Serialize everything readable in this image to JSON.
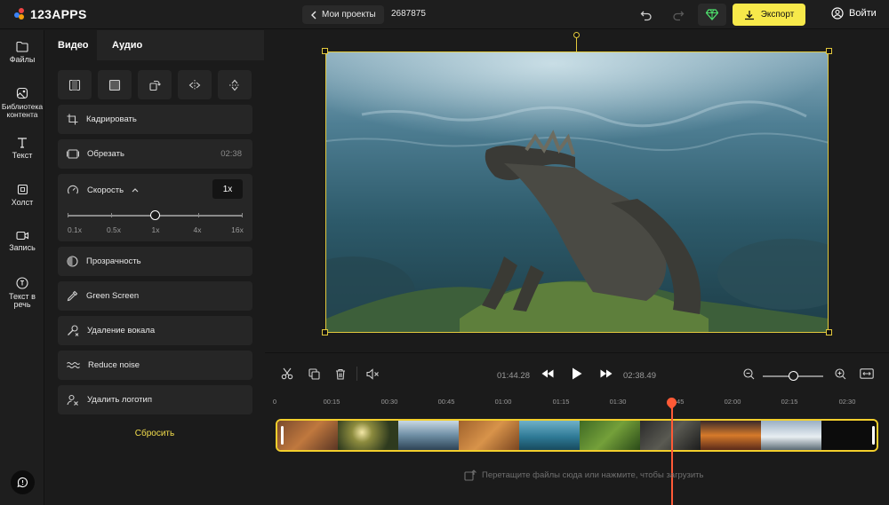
{
  "header": {
    "logo_text": "123APPS",
    "back_label": "Мои проекты",
    "project_id": "2687875",
    "export_label": "Экспорт",
    "login_label": "Войти"
  },
  "nav": {
    "items": [
      {
        "label": "Файлы"
      },
      {
        "label": "Библиотека контента"
      },
      {
        "label": "Текст"
      },
      {
        "label": "Холст"
      },
      {
        "label": "Запись"
      },
      {
        "label": "Текст в речь"
      }
    ]
  },
  "panel": {
    "tabs": [
      "Видео",
      "Аудио"
    ],
    "crop_label": "Кадрировать",
    "trim_label": "Обрезать",
    "trim_duration": "02:38",
    "speed_label": "Скорость",
    "speed_value": "1x",
    "speed_level": 0.5,
    "speed_marks": [
      "0.1x",
      "0.5x",
      "1x",
      "4x",
      "16x"
    ],
    "opacity_label": "Прозрачность",
    "green_screen_label": "Green Screen",
    "vocal_removal_label": "Удаление вокала",
    "reduce_noise_label": "Reduce noise",
    "remove_logo_label": "Удалить логотип",
    "reset_label": "Сбросить"
  },
  "player": {
    "current_time": "01:44.28",
    "total_time": "02:38.49",
    "zoom_level": 0.5
  },
  "timeline": {
    "ruler": [
      "0",
      "00:15",
      "00:30",
      "00:45",
      "01:00",
      "01:15",
      "01:30",
      "01:45",
      "02:00",
      "02:15",
      "02:30"
    ],
    "drop_hint": "Перетащите файлы сюда или нажмите, чтобы загрузить",
    "playhead_time": "01:45"
  },
  "colors": {
    "accent_yellow": "#f7e94a",
    "selection": "#e3c93d",
    "playhead": "#ff5a36",
    "premium_green": "#4ddf6b"
  }
}
